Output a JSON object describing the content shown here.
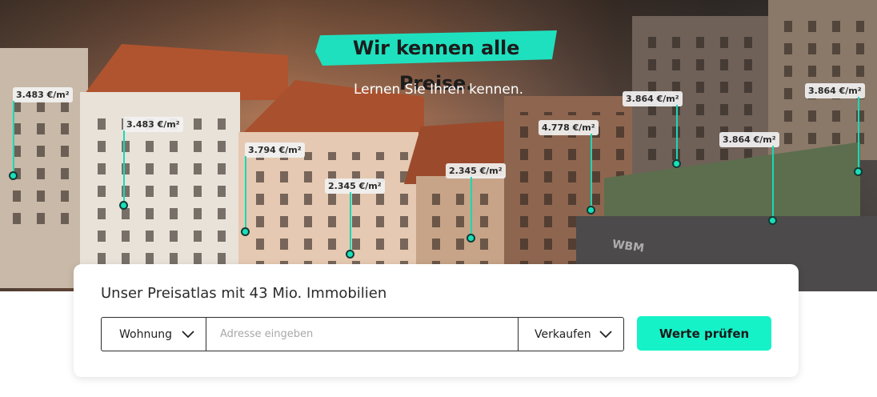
{
  "hero": {
    "headline": "Wir kennen alle Preise.",
    "subline": "Lernen Sie Ihren kennen.",
    "accent_color": "#1fe0be",
    "building_sign": "WBM",
    "price_markers": [
      {
        "label": "3.483 €/m²"
      },
      {
        "label": "3.483 €/m²"
      },
      {
        "label": "3.794 €/m²"
      },
      {
        "label": "2.345 €/m²"
      },
      {
        "label": "2.345 €/m²"
      },
      {
        "label": "4.778 €/m²"
      },
      {
        "label": "3.864 €/m²"
      },
      {
        "label": "3.864 €/m²"
      },
      {
        "label": "3.864 €/m²"
      }
    ]
  },
  "search": {
    "title": "Unser Preisatlas mit 43 Mio. Immobilien",
    "property_type": {
      "selected": "Wohnung",
      "icon": "chevron-down-icon"
    },
    "address": {
      "value": "",
      "placeholder": "Adresse eingeben"
    },
    "intent": {
      "selected": "Verkaufen",
      "icon": "chevron-down-icon"
    },
    "submit_label": "Werte prüfen",
    "submit_color": "#16f2c8"
  }
}
